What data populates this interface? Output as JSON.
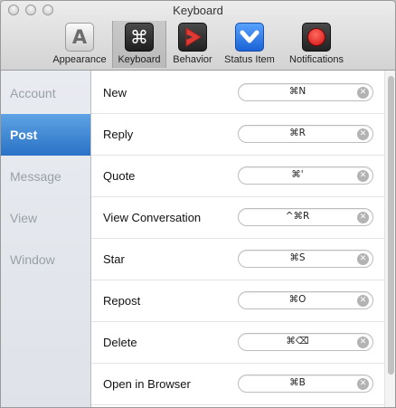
{
  "window": {
    "title": "Keyboard"
  },
  "toolbar": {
    "items": [
      {
        "label": "Appearance",
        "icon": "appearance-letter-a-icon",
        "glyph": "A"
      },
      {
        "label": "Keyboard",
        "icon": "command-key-icon",
        "glyph": "⌘"
      },
      {
        "label": "Behavior",
        "icon": "behavior-red-arrow-icon",
        "glyph": ">"
      },
      {
        "label": "Status Item",
        "icon": "status-item-blue-chevron-icon",
        "glyph": ""
      },
      {
        "label": "Notifications",
        "icon": "notifications-red-dot-icon",
        "glyph": ""
      }
    ],
    "selected": "Keyboard"
  },
  "sidebar": {
    "items": [
      {
        "label": "Account"
      },
      {
        "label": "Post"
      },
      {
        "label": "Message"
      },
      {
        "label": "View"
      },
      {
        "label": "Window"
      }
    ],
    "selected": "Post"
  },
  "shortcuts": [
    {
      "label": "New",
      "keys": "⌘N"
    },
    {
      "label": "Reply",
      "keys": "⌘R"
    },
    {
      "label": "Quote",
      "keys": "⌘'"
    },
    {
      "label": "View Conversation",
      "keys": "^⌘R"
    },
    {
      "label": "Star",
      "keys": "⌘S"
    },
    {
      "label": "Repost",
      "keys": "⌘O"
    },
    {
      "label": "Delete",
      "keys": "⌘⌫"
    },
    {
      "label": "Open in Browser",
      "keys": "⌘B"
    }
  ],
  "colors": {
    "accent": "#2a72c6",
    "sidebar_bg": "#e3e6eb",
    "traffic_light_inactive": "#d0d0d0"
  }
}
